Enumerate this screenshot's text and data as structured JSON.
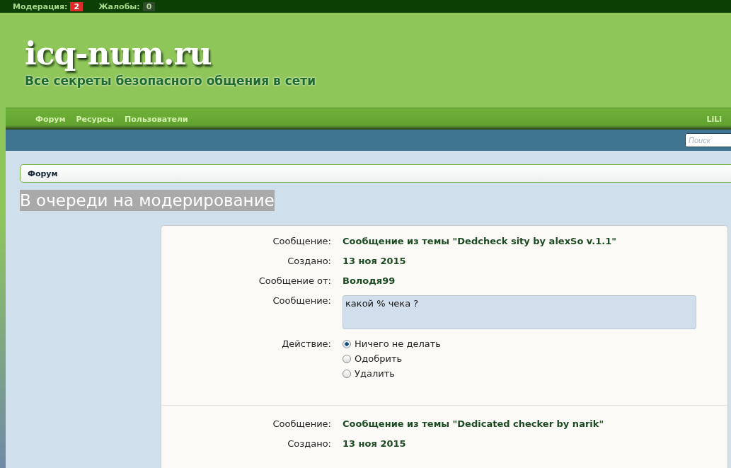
{
  "moderation_bar": [
    {
      "label": "Модерация:",
      "count": "2",
      "kind": "alert"
    },
    {
      "label": "Жалобы:",
      "count": "0",
      "kind": "plain"
    }
  ],
  "header": {
    "logo": "icq-num.ru",
    "tagline": "Все секреты безопасного общения в сети"
  },
  "nav": {
    "items": [
      {
        "label": "Форум"
      },
      {
        "label": "Ресурсы"
      },
      {
        "label": "Пользователи"
      }
    ],
    "user": "LiLi"
  },
  "search": {
    "placeholder": "Поиск"
  },
  "breadcrumb": [
    "Форум"
  ],
  "page_title": "В очереди на модерирование",
  "queue": [
    {
      "fields": [
        {
          "label": "Сообщение:",
          "value": "Сообщение из темы \"Dedcheck sity by alexSo v.1.1\""
        },
        {
          "label": "Создано:",
          "value": "13 ноя 2015"
        },
        {
          "label": "Сообщение от:",
          "value": "Володя99"
        }
      ],
      "message": {
        "label": "Сообщение:",
        "text": "какой % чека ?"
      },
      "action": {
        "label": "Действие:",
        "options": [
          {
            "label": "Ничего не делать",
            "selected": true
          },
          {
            "label": "Одобрить",
            "selected": false
          },
          {
            "label": "Удалить",
            "selected": false
          }
        ]
      }
    },
    {
      "fields": [
        {
          "label": "Сообщение:",
          "value": "Сообщение из темы \"Dedicated checker by narik\""
        },
        {
          "label": "Создано:",
          "value": "13 ноя 2015"
        }
      ]
    }
  ]
}
